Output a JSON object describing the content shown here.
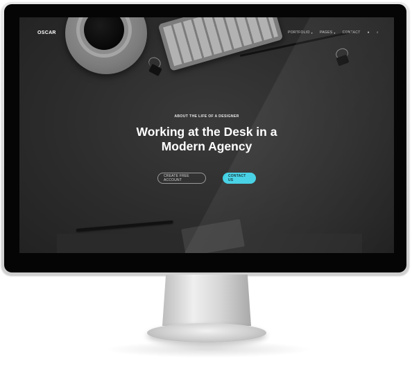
{
  "site": {
    "logo": "OSCAR"
  },
  "nav": {
    "items": [
      {
        "label": "PORTFOLIO",
        "has_caret": true
      },
      {
        "label": "PAGES",
        "has_caret": true
      },
      {
        "label": "CONTACT",
        "has_caret": false
      }
    ],
    "icons": [
      "cart-icon",
      "search-icon"
    ]
  },
  "hero": {
    "eyebrow": "ABOUT THE LIFE OF A DESIGNER",
    "headline_line1": "Working at the Desk in a",
    "headline_line2": "Modern Agency",
    "buttons": {
      "primary": "CREATE FREE ACCOUNT",
      "secondary": "CONTACT US"
    }
  },
  "colors": {
    "accent": "#3fd0e4",
    "background": "#2e2e2e",
    "text": "#ffffff"
  }
}
